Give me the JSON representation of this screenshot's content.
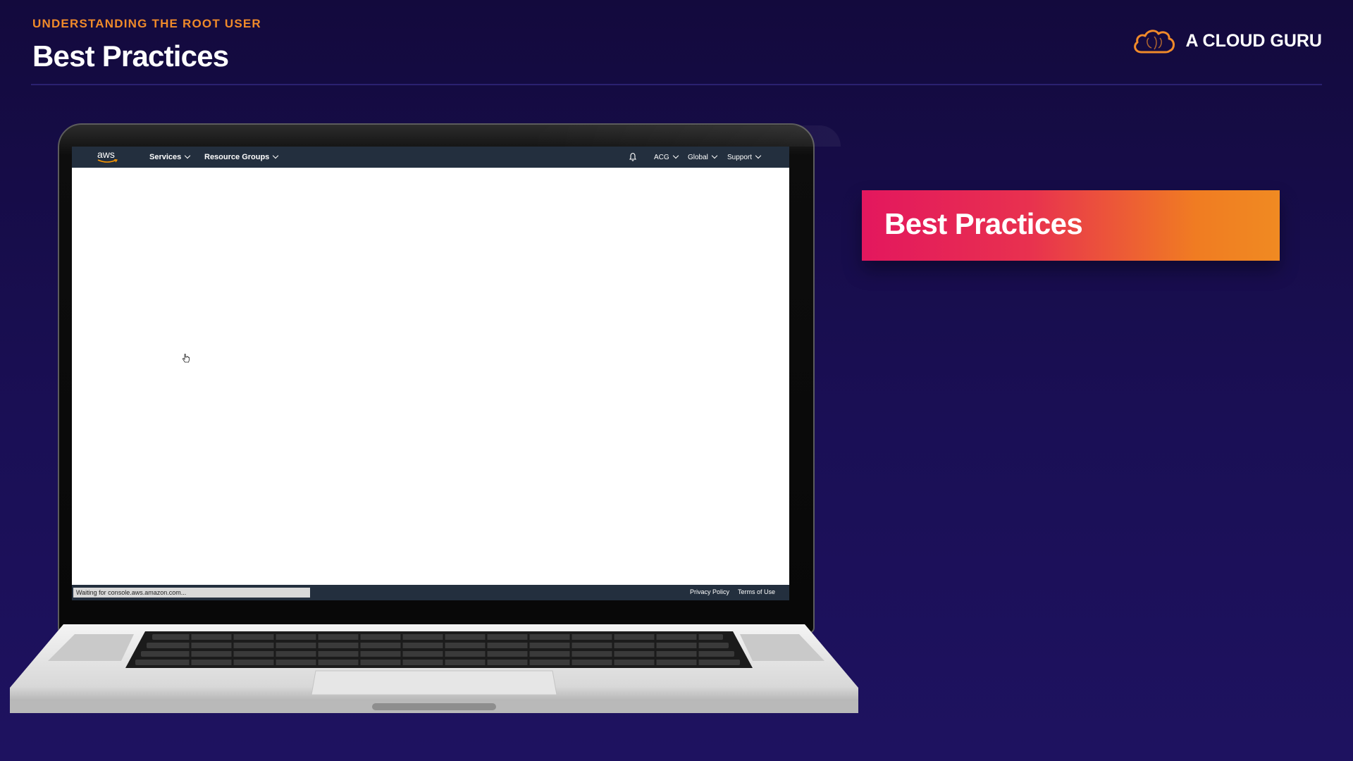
{
  "header": {
    "eyebrow": "UNDERSTANDING THE ROOT USER",
    "title": "Best Practices",
    "brand_name": "A CLOUD GURU"
  },
  "callout": {
    "label": "Best Practices",
    "gradient_start": "#e3175e",
    "gradient_end": "#f07c22"
  },
  "aws_console": {
    "logo": "aws",
    "nav": {
      "services": "Services",
      "resource_groups": "Resource Groups",
      "account": "ACG",
      "region": "Global",
      "support": "Support"
    },
    "footer": {
      "status_text": "Waiting for console.aws.amazon.com...",
      "privacy": "Privacy Policy",
      "terms": "Terms of Use"
    },
    "colors": {
      "nav_bg": "#232f3e",
      "accent": "#ff9900"
    }
  },
  "colors": {
    "background": "#160c47",
    "eyebrow": "#f08a2a",
    "brand_icon": "#f08a2a"
  }
}
